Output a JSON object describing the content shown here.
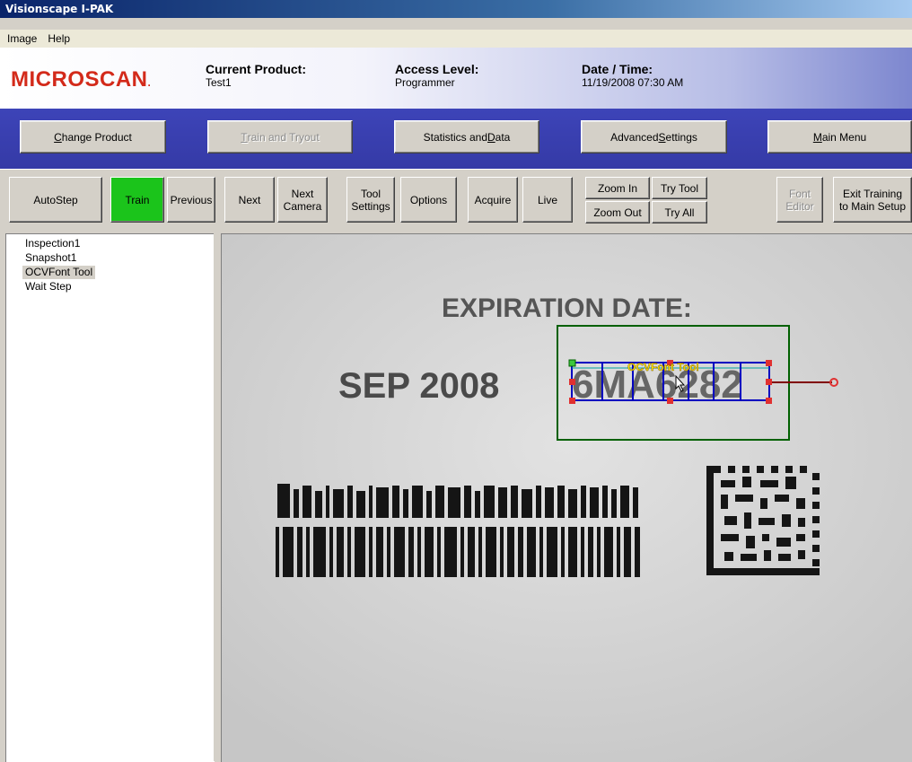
{
  "window": {
    "title": "Visionscape I-PAK"
  },
  "menu": {
    "items": [
      "Image",
      "Help"
    ]
  },
  "header": {
    "logo": "MICROSCAN",
    "current_product_label": "Current Product:",
    "current_product_value": "Test1",
    "access_level_label": "Access Level:",
    "access_level_value": "Programmer",
    "datetime_label": "Date / Time:",
    "datetime_value": "11/19/2008 07:30 AM"
  },
  "nav": {
    "change_product": {
      "pre": "",
      "u": "C",
      "post": "hange Product"
    },
    "train_tryout": {
      "pre": "",
      "u": "T",
      "post": "rain and Tryout"
    },
    "statistics": {
      "pre": "Statistics and ",
      "u": "D",
      "post": "ata"
    },
    "advanced": {
      "pre": "Advanced ",
      "u": "S",
      "post": "ettings"
    },
    "main_menu": {
      "pre": "",
      "u": "M",
      "post": "ain Menu"
    }
  },
  "toolbar": {
    "autostep": "AutoStep",
    "train": "Train",
    "previous": "Previous",
    "next": "Next",
    "next_camera": [
      "Next",
      "Camera"
    ],
    "tool_settings": [
      "Tool",
      "Settings"
    ],
    "options": "Options",
    "acquire": "Acquire",
    "live": "Live",
    "zoom_in": "Zoom In",
    "zoom_out": "Zoom Out",
    "try_tool": "Try Tool",
    "try_all": "Try All",
    "font_editor": [
      "Font",
      "Editor"
    ],
    "exit_training": [
      "Exit Training",
      "to Main Setup"
    ]
  },
  "tree": {
    "items": [
      "Inspection1",
      "Snapshot1",
      "OCVFont Tool",
      "Wait Step"
    ],
    "selected_index": 2
  },
  "image": {
    "heading": "EXPIRATION DATE:",
    "date_text": "SEP 2008",
    "code_text": "6MA6282",
    "tool_label": "OCVFont Tool"
  },
  "colors": {
    "train_active": "#1bc41b",
    "nav_bar": "#3a3fb0",
    "logo": "#d32a1a"
  }
}
